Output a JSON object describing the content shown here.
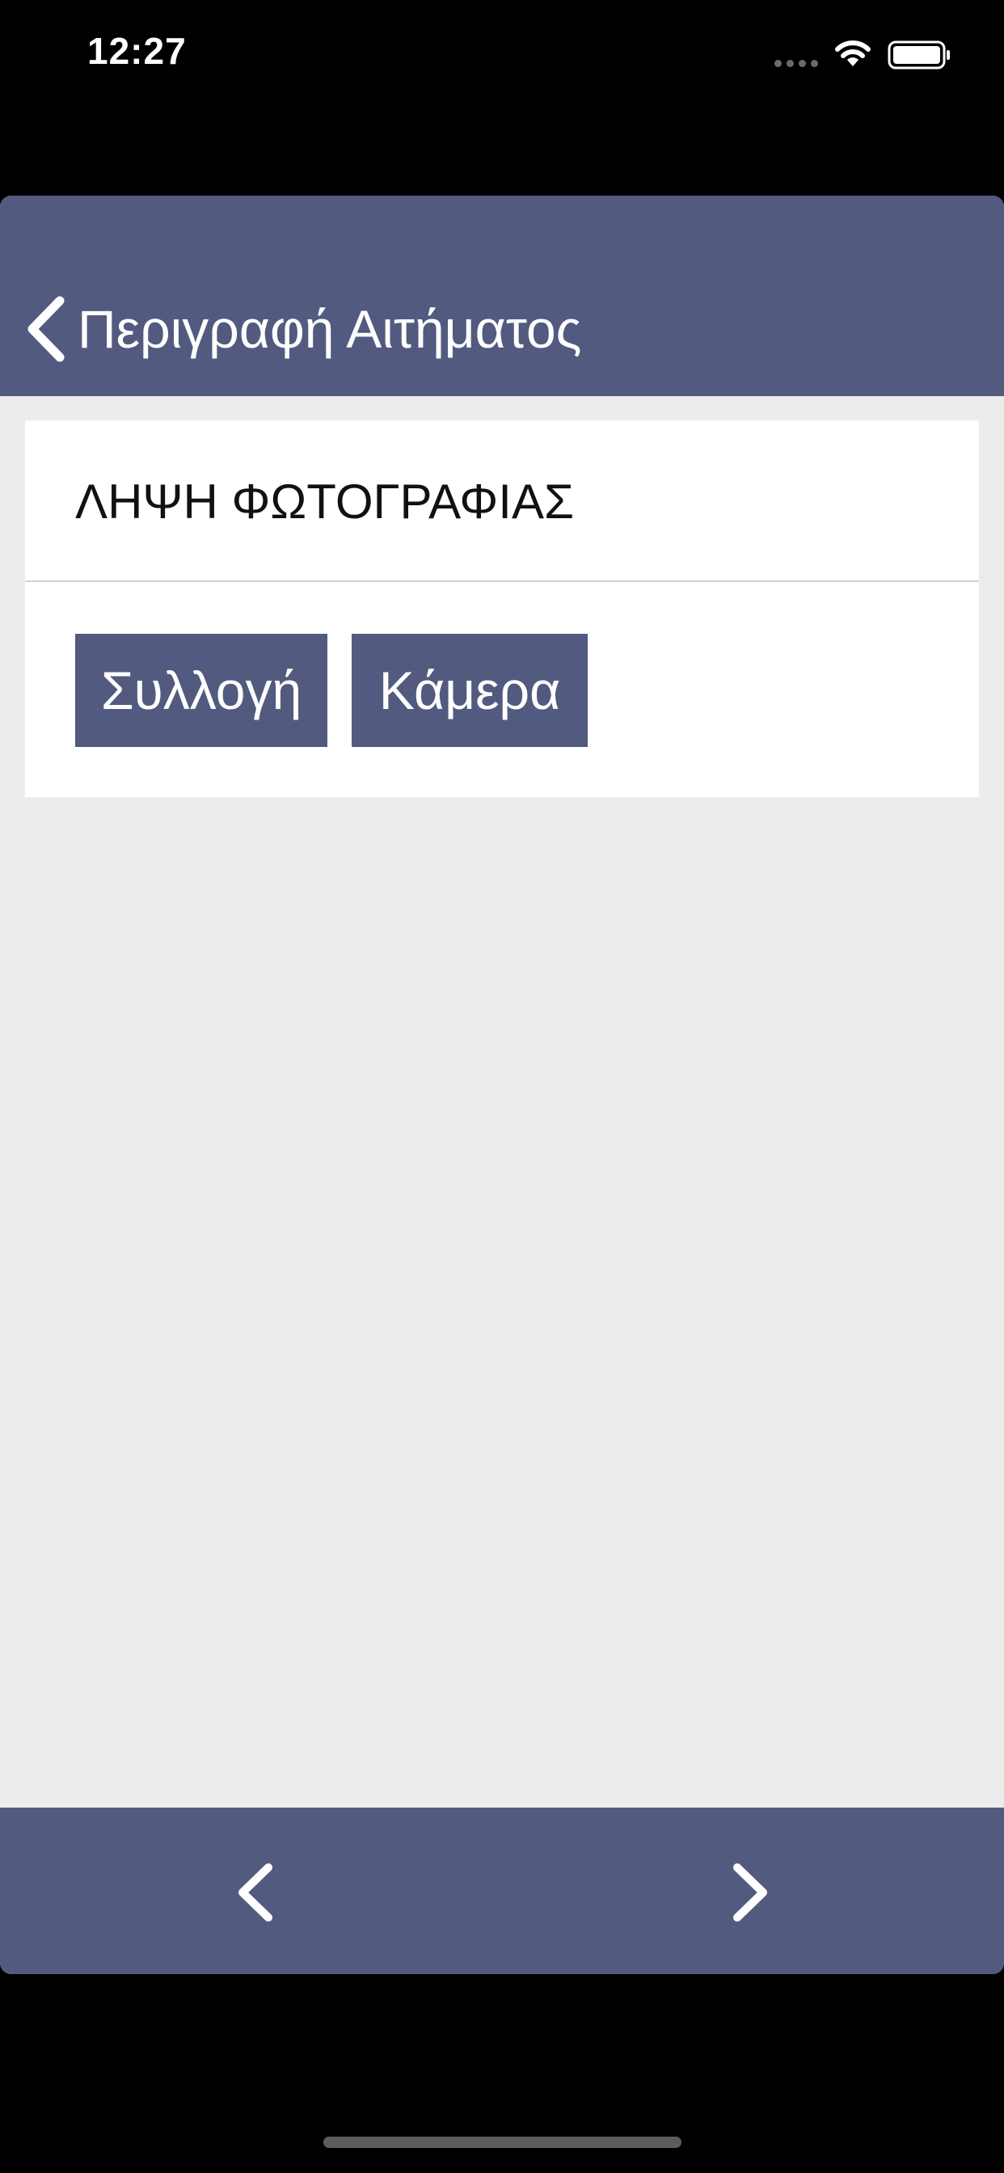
{
  "status_bar": {
    "time": "12:27",
    "icons": [
      "cellular-signal-icon",
      "wifi-icon",
      "battery-icon"
    ]
  },
  "nav_bar": {
    "back_icon": "chevron-left-icon",
    "title": "Περιγραφή Αιτήματος"
  },
  "photo_card": {
    "title": "ΛΗΨΗ ΦΩΤΟΓΡΑΦΙΑΣ",
    "gallery_button_label": "Συλλογή",
    "camera_button_label": "Κάμερα"
  },
  "bottom_bar": {
    "prev_icon": "chevron-left-icon",
    "next_icon": "chevron-right-icon"
  },
  "colors": {
    "accent": "#535a7f",
    "background": "#ececec",
    "card": "#ffffff"
  }
}
